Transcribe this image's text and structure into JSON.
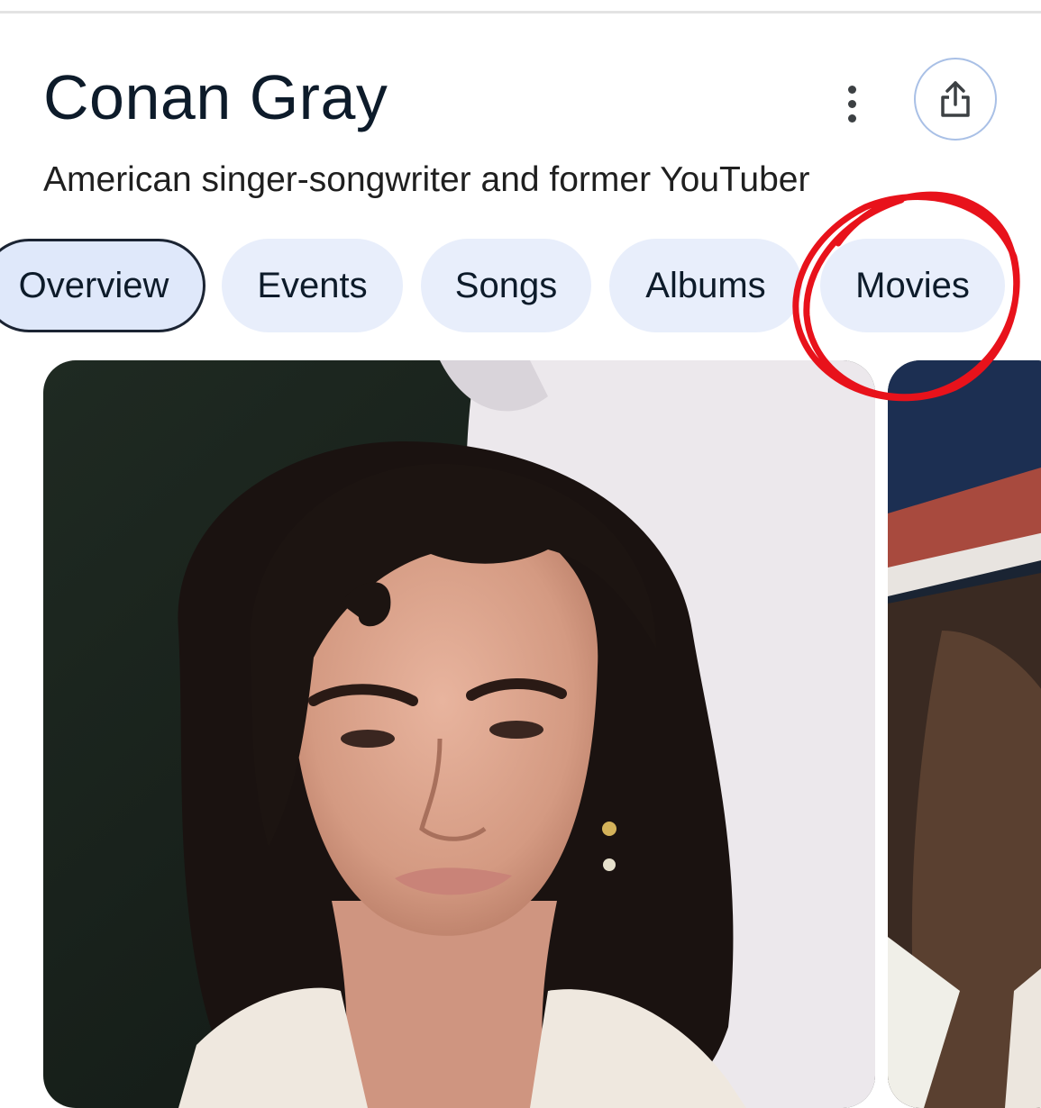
{
  "entity": {
    "title": "Conan Gray",
    "description": "American singer-songwriter and former YouTuber"
  },
  "actions": {
    "more_icon": "vertical-dots-icon",
    "share_icon": "share-icon"
  },
  "tabs": [
    {
      "label": "Overview",
      "active": true
    },
    {
      "label": "Events",
      "active": false
    },
    {
      "label": "Songs",
      "active": false
    },
    {
      "label": "Albums",
      "active": false
    },
    {
      "label": "Movies",
      "active": false
    }
  ],
  "annotation": {
    "color": "#e8121b",
    "target": "Movies"
  },
  "colors": {
    "chip_background": "#e8eefb",
    "chip_active_border": "#1b2433",
    "title_text": "#0d1b2a",
    "share_border": "#a9c0e6"
  }
}
